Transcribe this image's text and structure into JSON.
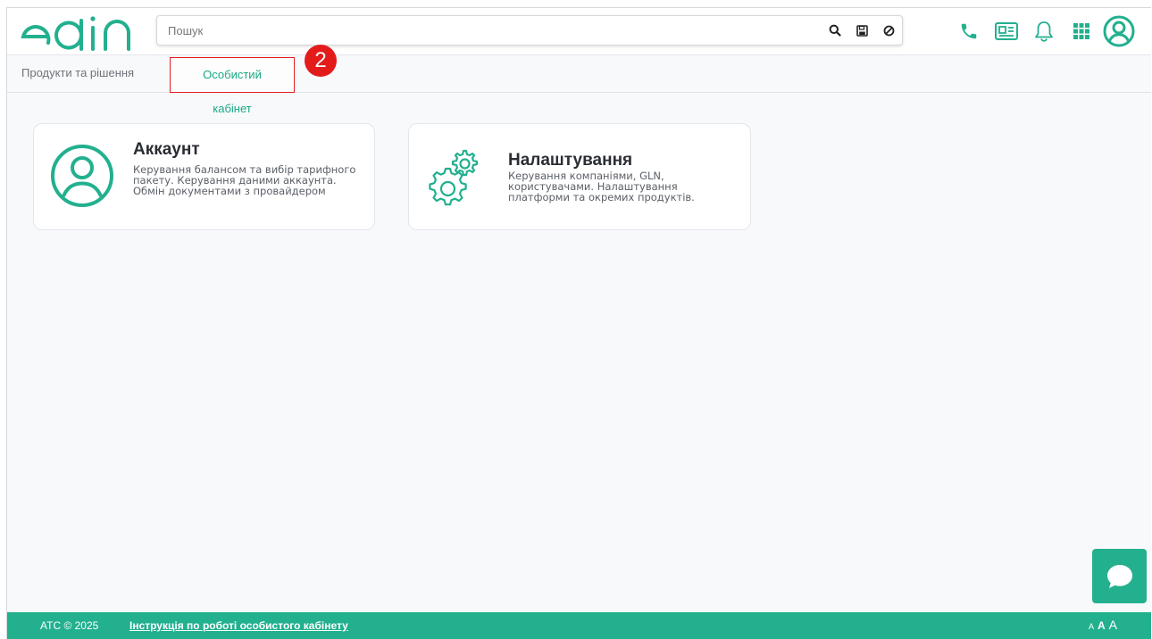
{
  "header": {
    "search": {
      "placeholder": "Пошук"
    },
    "colors": {
      "brand": "#22b08e",
      "text_dark": "#2a2e33"
    },
    "icons": [
      "search-icon",
      "save-icon",
      "clear-icon",
      "phone-icon",
      "news-icon",
      "bell-icon",
      "apps-grid-icon",
      "user-profile-icon"
    ]
  },
  "tabs": {
    "products": "Продукти та рішення",
    "cabinet": "Особистий кабінет",
    "marker": "2"
  },
  "cards": {
    "account": {
      "title": "Аккаунт",
      "desc": "Керування балансом та вибір тарифного пакету. Керування даними аккаунта. Обмін документами з провайдером"
    },
    "settings": {
      "title": "Налаштування",
      "desc": "Керування компаніями, GLN, користувачами. Налаштування платформи та окремих продуктів."
    }
  },
  "footer": {
    "copyright": "ATC © 2025",
    "link": "Інструкція по роботі особистого кабінету",
    "font_small": "A",
    "font_medium": "A",
    "font_large": "A"
  }
}
